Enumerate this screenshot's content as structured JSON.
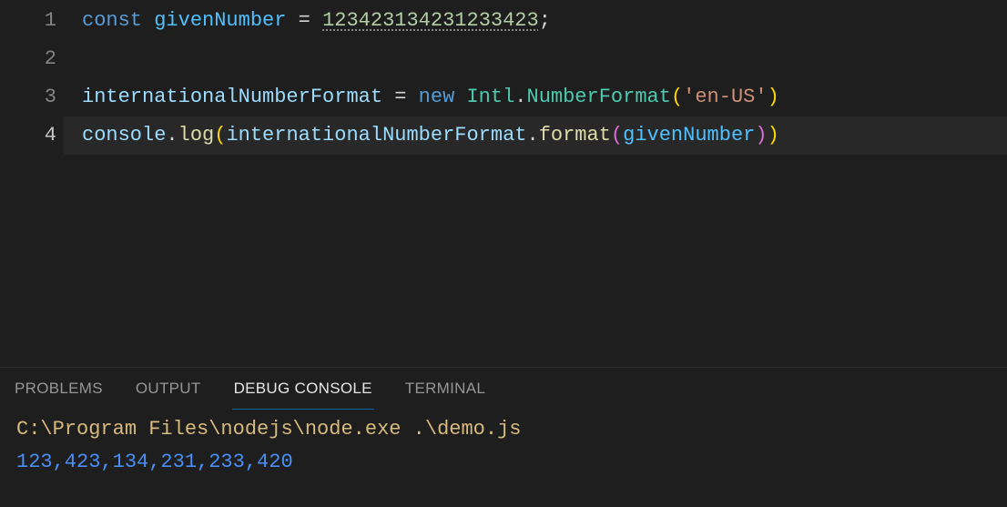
{
  "editor": {
    "active_line": 4,
    "lines": [
      {
        "n": 1,
        "tokens": [
          {
            "t": "const ",
            "c": "tok-keyword"
          },
          {
            "t": "givenNumber",
            "c": "tok-const"
          },
          {
            "t": " = ",
            "c": "tok-op"
          },
          {
            "t": "123423134231233423",
            "c": "tok-number underline-warn"
          },
          {
            "t": ";",
            "c": "tok-punct"
          }
        ]
      },
      {
        "n": 2,
        "tokens": []
      },
      {
        "n": 3,
        "tokens": [
          {
            "t": "internationalNumberFormat",
            "c": "tok-var"
          },
          {
            "t": " = ",
            "c": "tok-op"
          },
          {
            "t": "new ",
            "c": "tok-keyword"
          },
          {
            "t": "Intl",
            "c": "tok-class"
          },
          {
            "t": ".",
            "c": "tok-punct"
          },
          {
            "t": "NumberFormat",
            "c": "tok-class"
          },
          {
            "t": "(",
            "c": "tok-brack-y"
          },
          {
            "t": "'en-US'",
            "c": "tok-string"
          },
          {
            "t": ")",
            "c": "tok-brack-y"
          }
        ]
      },
      {
        "n": 4,
        "tokens": [
          {
            "t": "console",
            "c": "tok-var"
          },
          {
            "t": ".",
            "c": "tok-punct"
          },
          {
            "t": "log",
            "c": "tok-func"
          },
          {
            "t": "(",
            "c": "tok-brack-y"
          },
          {
            "t": "internationalNumberFormat",
            "c": "tok-var"
          },
          {
            "t": ".",
            "c": "tok-punct"
          },
          {
            "t": "format",
            "c": "tok-func"
          },
          {
            "t": "(",
            "c": "tok-brack-p"
          },
          {
            "t": "givenNumber",
            "c": "tok-const"
          },
          {
            "t": ")",
            "c": "tok-brack-p"
          },
          {
            "t": ")",
            "c": "tok-brack-y"
          }
        ]
      }
    ]
  },
  "panel": {
    "tabs": {
      "problems": "PROBLEMS",
      "output": "OUTPUT",
      "debug_console": "DEBUG CONSOLE",
      "terminal": "TERMINAL"
    },
    "active_tab": "debug_console",
    "console": {
      "command": "C:\\Program Files\\nodejs\\node.exe .\\demo.js",
      "output": "123,423,134,231,233,420"
    }
  }
}
